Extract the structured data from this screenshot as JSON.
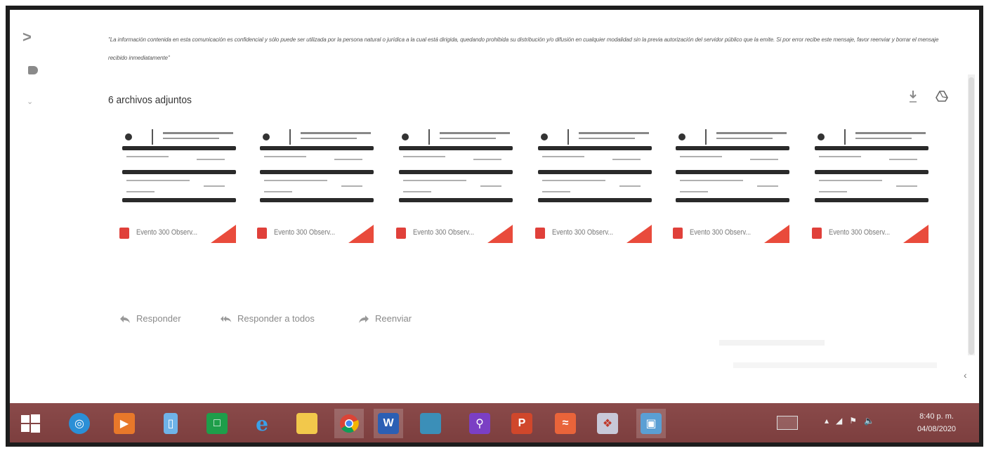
{
  "disclaimer": "\"La información contenida en esta comunicación es confidencial y sólo puede ser utilizada por la persona natural o jurídica a la cual está dirigida, quedando prohibida su distribución y/o difusión en cualquier modalidad sin la previa autorización del servidor público que la emite. Si por error recibe este mensaje, favor reenviar y borrar el mensaje recibido inmediatamente\"",
  "attachments": {
    "title": "6 archivos adjuntos",
    "items": [
      {
        "name": "Evento 300 Observ..."
      },
      {
        "name": "Evento 300 Observ..."
      },
      {
        "name": "Evento 300 Observ..."
      },
      {
        "name": "Evento 300 Observ..."
      },
      {
        "name": "Evento 300 Observ..."
      },
      {
        "name": "Evento 300 Observ..."
      }
    ]
  },
  "actions": {
    "reply": "Responder",
    "reply_all": "Responder a todos",
    "forward": "Reenviar"
  },
  "taskbar": {
    "clock_time": "8:40 p. m.",
    "clock_date": "04/08/2020",
    "icons": [
      "windows-start",
      "network-icon",
      "media-player",
      "tablet-app",
      "excel-app",
      "internet-explorer",
      "file-explorer",
      "chrome",
      "word",
      "photos",
      "search-app",
      "powerpoint",
      "acrobat",
      "shield-app",
      "remote-desktop"
    ]
  },
  "colors": {
    "taskbar": "#7c3e3e",
    "pdf_red": "#e0403a",
    "accent_corner": "#e94b3c"
  }
}
